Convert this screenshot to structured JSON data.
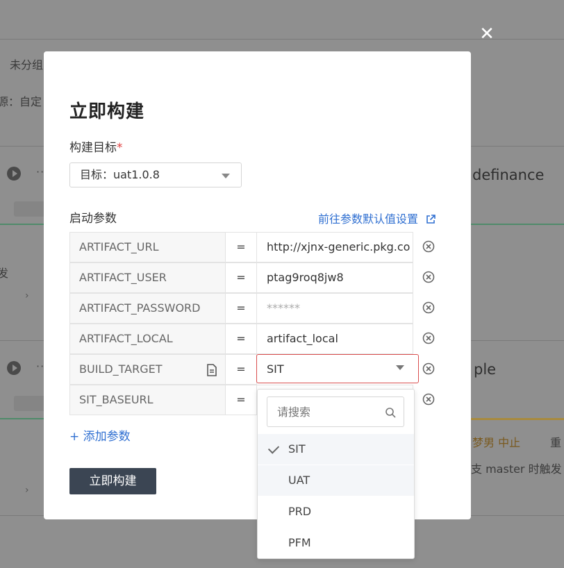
{
  "background": {
    "texts": [
      "未分组",
      "源：自定",
      "发",
      "definance",
      "ple",
      "梦男 中止",
      "重",
      "支 master 时触发"
    ]
  },
  "modal": {
    "title": "立即构建",
    "target_label": "构建目标",
    "required_mark": "*",
    "target_select": "目标：uat1.0.8",
    "params_label": "启动参数",
    "defaults_link": "前往参数默认值设置",
    "equals": "=",
    "params": [
      {
        "name": "ARTIFACT_URL",
        "value": "http://xjnx-generic.pkg.co"
      },
      {
        "name": "ARTIFACT_USER",
        "value": "ptag9roq8jw8"
      },
      {
        "name": "ARTIFACT_PASSWORD",
        "value": "******"
      },
      {
        "name": "ARTIFACT_LOCAL",
        "value": "artifact_local"
      },
      {
        "name": "BUILD_TARGET",
        "value": "SIT"
      },
      {
        "name": "SIT_BASEURL",
        "value": ""
      }
    ],
    "add_param": "+ 添加参数",
    "build_button": "立即构建"
  },
  "dropdown": {
    "search_placeholder": "请搜索",
    "options": [
      "SIT",
      "UAT",
      "PRD",
      "PFM"
    ],
    "selected": "SIT"
  },
  "colors": {
    "link": "#2f6fd1",
    "error_border": "#d94d4d",
    "button_bg": "#3b4553"
  },
  "icons": [
    "close-icon",
    "chevron-down-icon",
    "external-link-icon",
    "remove-circle-icon",
    "document-icon",
    "search-icon",
    "check-icon"
  ]
}
